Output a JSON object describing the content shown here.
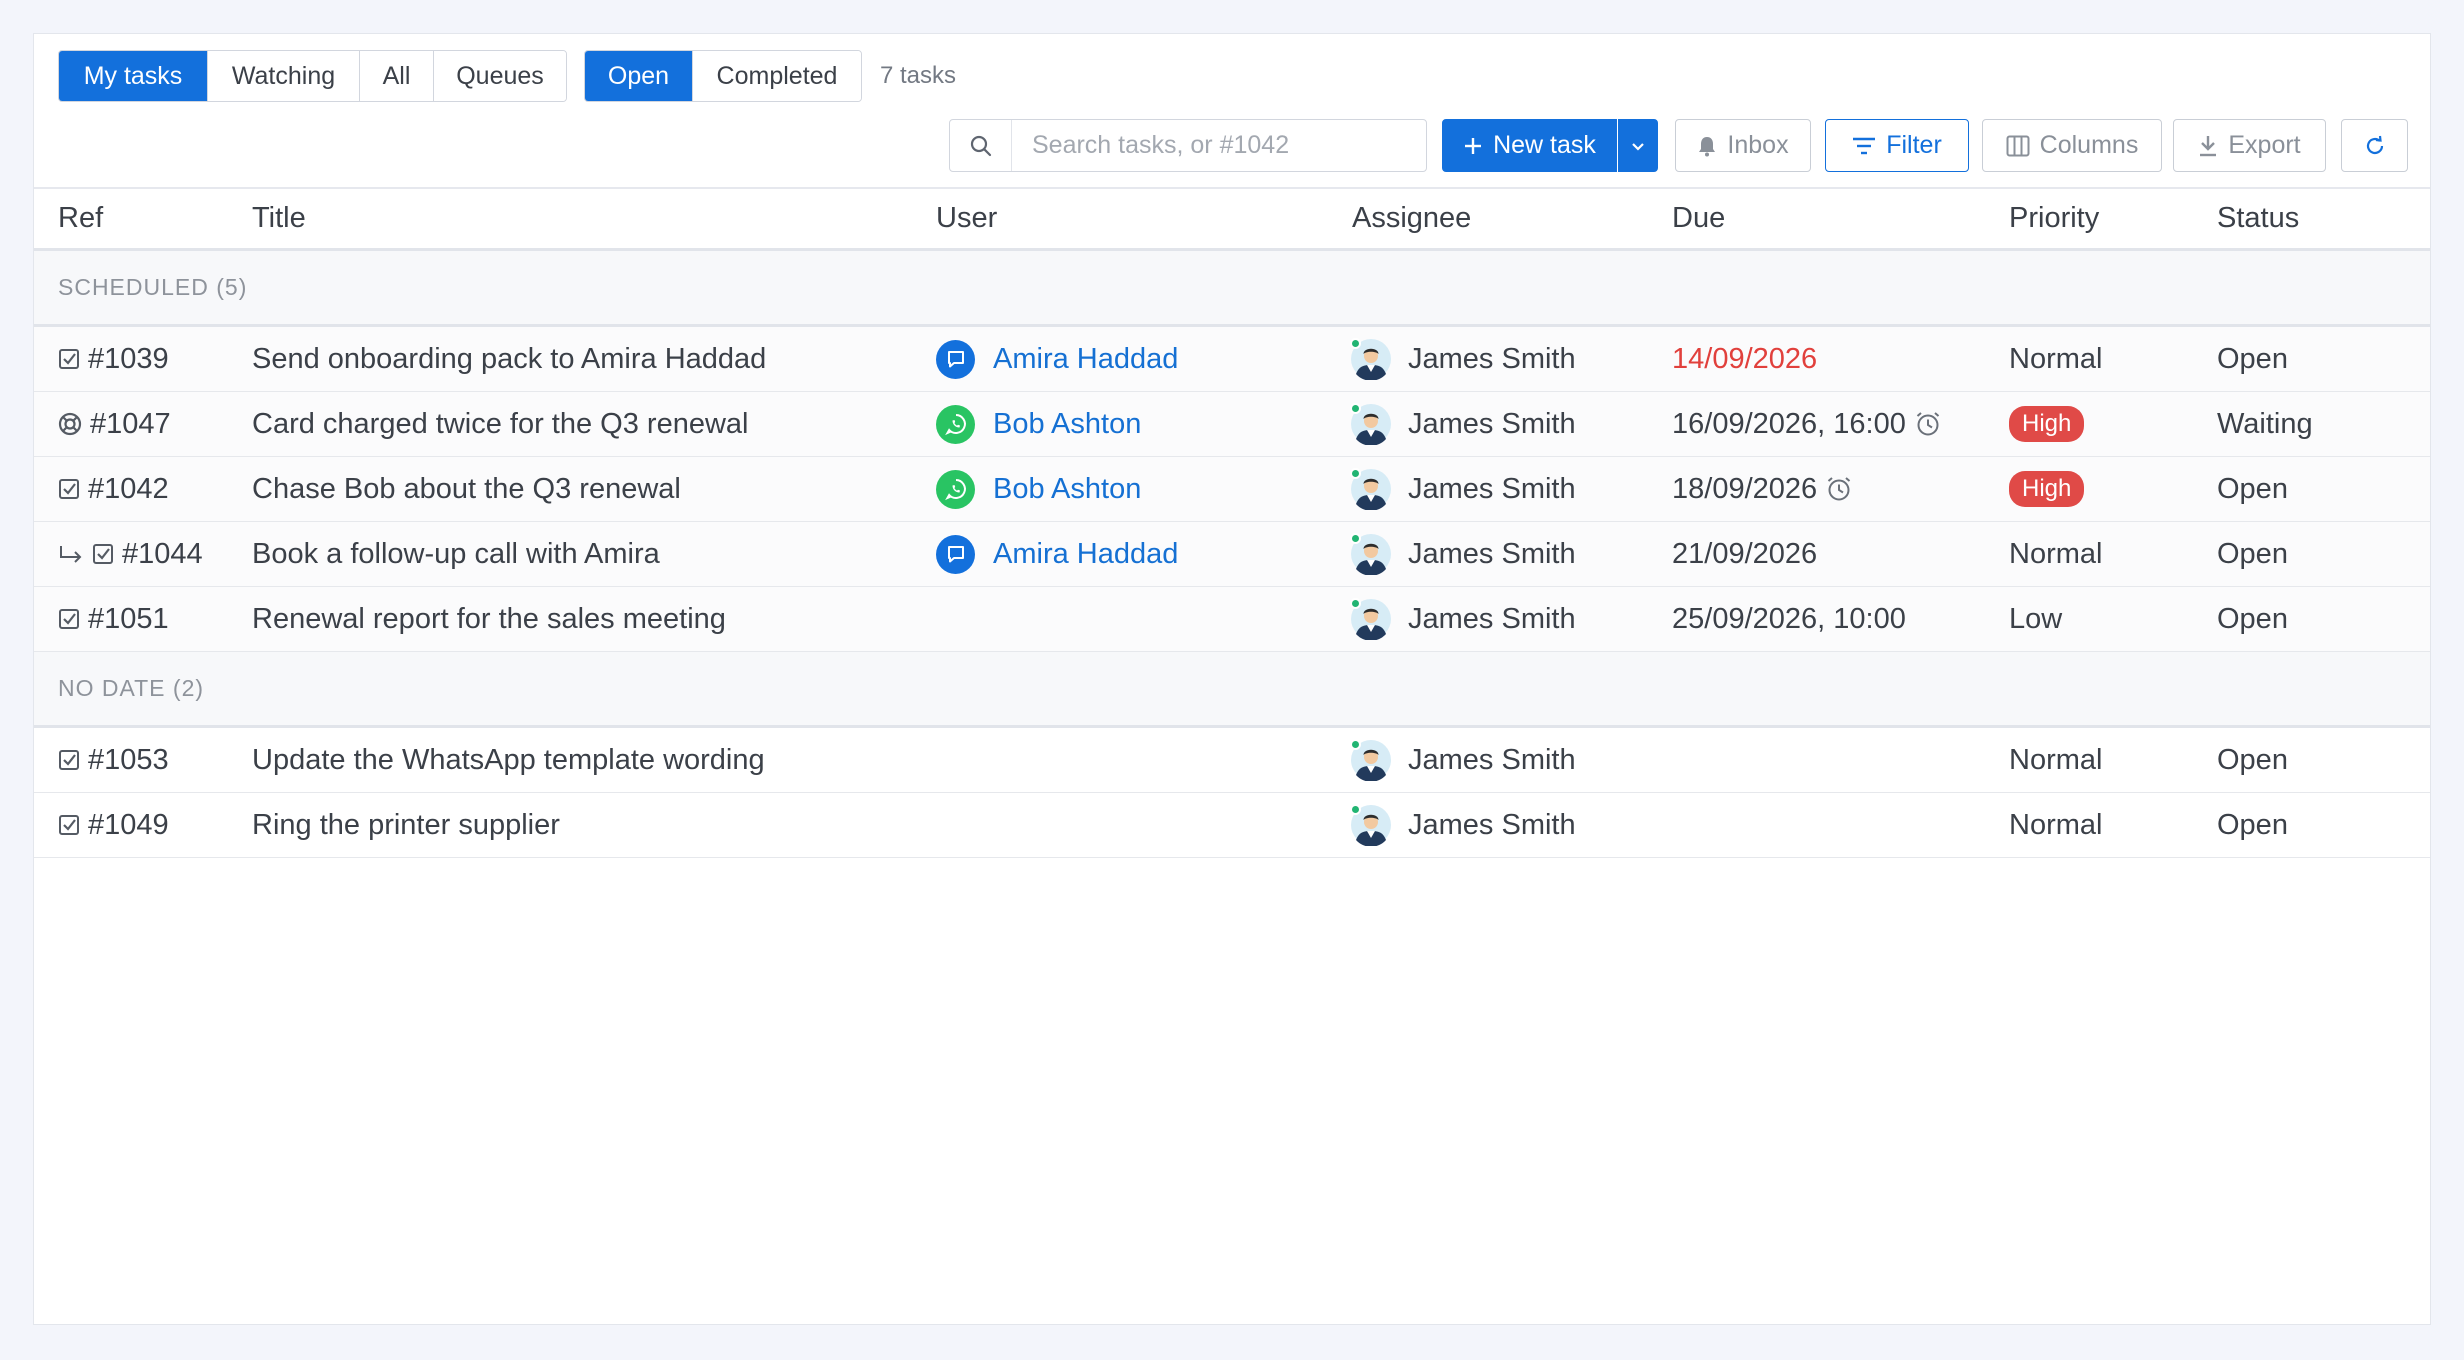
{
  "view_tabs": [
    "My tasks",
    "Watching",
    "All",
    "Queues"
  ],
  "state_tabs": [
    "Open",
    "Completed"
  ],
  "task_count": "7 tasks",
  "search": {
    "placeholder": "Search tasks, or #1042"
  },
  "toolbar": {
    "new_task": "New task",
    "inbox": "Inbox",
    "filter": "Filter",
    "columns": "Columns",
    "export": "Export"
  },
  "columns": {
    "ref": "Ref",
    "title": "Title",
    "user": "User",
    "assignee": "Assignee",
    "due": "Due",
    "priority": "Priority",
    "status": "Status"
  },
  "groups": [
    {
      "label": "SCHEDULED (5)",
      "rows": [
        {
          "icon": "task-checkbox-icon",
          "ref": "#1039",
          "title": "Send onboarding pack to Amira Haddad",
          "channel": "chat",
          "user": "Amira Haddad",
          "assignee": "James Smith",
          "due": "14/09/2026",
          "due_overdue": true,
          "reminder": false,
          "priority": "Normal",
          "status": "Open"
        },
        {
          "icon": "support-ticket-icon",
          "ref": "#1047",
          "title": "Card charged twice for the Q3 renewal",
          "channel": "whatsapp",
          "user": "Bob Ashton",
          "assignee": "James Smith",
          "due": "16/09/2026, 16:00",
          "due_overdue": false,
          "reminder": true,
          "priority": "High",
          "status": "Waiting"
        },
        {
          "icon": "task-checkbox-icon",
          "ref": "#1042",
          "title": "Chase Bob about the Q3 renewal",
          "channel": "whatsapp",
          "user": "Bob Ashton",
          "assignee": "James Smith",
          "due": "18/09/2026",
          "due_overdue": false,
          "reminder": true,
          "priority": "High",
          "status": "Open"
        },
        {
          "icon": "subtask-checkbox-icon",
          "ref": "#1044",
          "title": "Book a follow-up call with Amira",
          "channel": "chat",
          "user": "Amira Haddad",
          "assignee": "James Smith",
          "due": "21/09/2026",
          "due_overdue": false,
          "reminder": false,
          "priority": "Normal",
          "status": "Open"
        },
        {
          "icon": "task-checkbox-icon",
          "ref": "#1051",
          "title": "Renewal report for the sales meeting",
          "channel": "",
          "user": "",
          "assignee": "James Smith",
          "due": "25/09/2026, 10:00",
          "due_overdue": false,
          "reminder": false,
          "priority": "Low",
          "status": "Open"
        }
      ]
    },
    {
      "label": "NO DATE (2)",
      "rows": [
        {
          "icon": "task-checkbox-icon",
          "ref": "#1053",
          "title": "Update the WhatsApp template wording",
          "channel": "",
          "user": "",
          "assignee": "James Smith",
          "due": "",
          "due_overdue": false,
          "reminder": false,
          "priority": "Normal",
          "status": "Open"
        },
        {
          "icon": "task-checkbox-icon",
          "ref": "#1049",
          "title": "Ring the printer supplier",
          "channel": "",
          "user": "",
          "assignee": "James Smith",
          "due": "",
          "due_overdue": false,
          "reminder": false,
          "priority": "Normal",
          "status": "Open"
        }
      ]
    }
  ],
  "colors": {
    "accent": "#1370dc",
    "whatsapp": "#29c463",
    "overdue": "#e1403c",
    "badge_high": "#e04a47",
    "online": "#22b573"
  }
}
